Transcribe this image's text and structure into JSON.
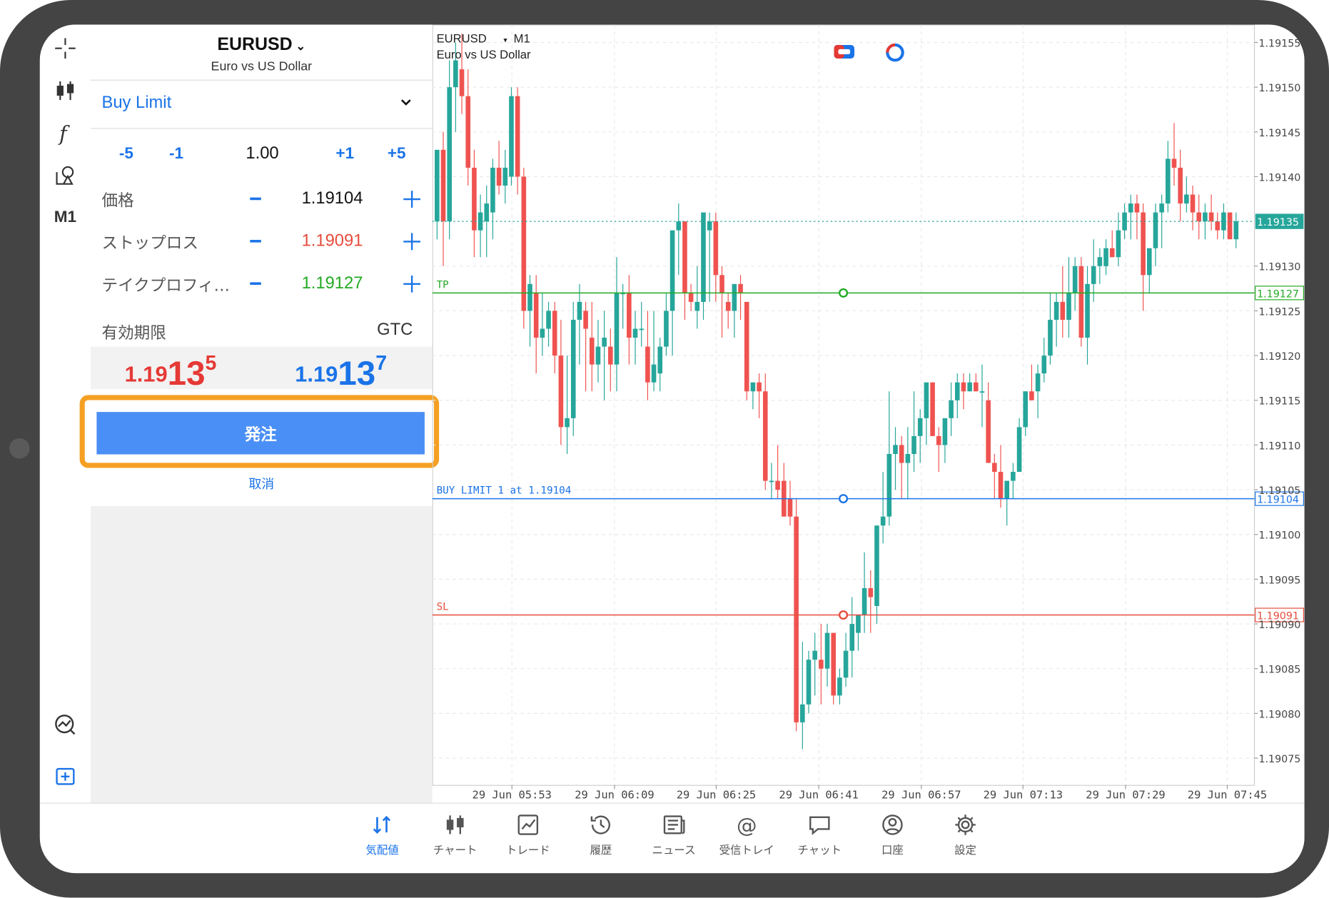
{
  "colors": {
    "bull": "#26a69a",
    "bear": "#ef5350",
    "accent": "#1a73e8",
    "tp": "#22aa22",
    "sl": "#e74c3c",
    "highlight": "#f5a023"
  },
  "toolbar": {
    "icons": [
      "crosshair-icon",
      "candles-icon",
      "function-icon",
      "objects-icon"
    ],
    "timeframe": "M1",
    "bottom_icons": [
      "analytics-icon",
      "new-order-icon"
    ]
  },
  "order": {
    "symbol": "EURUSD",
    "symbol_desc": "Euro vs US Dollar",
    "type": "Buy Limit",
    "volume_steps": [
      "-5",
      "-1",
      "+1",
      "+5"
    ],
    "volume": "1.00",
    "rows": [
      {
        "label": "価格",
        "value": "1.19104",
        "color": "#111111"
      },
      {
        "label": "ストップロス",
        "value": "1.19091",
        "color": "#e74c3c"
      },
      {
        "label": "テイクプロフィ…",
        "value": "1.19127",
        "color": "#22aa22"
      }
    ],
    "expiry_label": "有効期限",
    "expiry_value": "GTC",
    "bid": {
      "small": "1.19",
      "big": "13",
      "sup": "5"
    },
    "ask": {
      "small": "1.19",
      "big": "13",
      "sup": "7"
    },
    "place_button": "発注",
    "cancel_link": "取消"
  },
  "chart_data": {
    "type": "candlestick",
    "symbol": "EURUSD",
    "timeframe": "M1",
    "title": "EURUSD",
    "subtitle": "Euro vs US Dollar",
    "ylim": [
      1.19072,
      1.19157
    ],
    "y_ticks": [
      "1.19155",
      "1.19150",
      "1.19145",
      "1.19140",
      "1.19130",
      "1.19125",
      "1.19120",
      "1.19115",
      "1.19110",
      "1.19105",
      "1.19100",
      "1.19095",
      "1.19090",
      "1.19085",
      "1.19080",
      "1.19075"
    ],
    "x_ticks": [
      "29 Jun 05:53",
      "29 Jun 06:09",
      "29 Jun 06:25",
      "29 Jun 06:41",
      "29 Jun 06:57",
      "29 Jun 07:13",
      "29 Jun 07:29",
      "29 Jun 07:45"
    ],
    "current_price": "1.19135",
    "lines": [
      {
        "name": "TP",
        "label": "TP",
        "price": "1.19127",
        "color": "#22aa22",
        "style": "solid"
      },
      {
        "name": "BUY LIMIT",
        "label": "BUY LIMIT 1 at 1.19104",
        "price": "1.19104",
        "color": "#1a73e8",
        "style": "solid"
      },
      {
        "name": "SL",
        "label": "SL",
        "price": "1.19091",
        "color": "#e74c3c",
        "style": "solid"
      },
      {
        "name": "Bid",
        "label": "",
        "price": "1.19135",
        "color": "#26a69a",
        "style": "dotted"
      }
    ],
    "candles": [
      {
        "o": 1.19135,
        "h": 1.1914,
        "l": 1.19133,
        "c": 1.19143
      },
      {
        "o": 1.19143,
        "h": 1.19145,
        "l": 1.1913,
        "c": 1.19135
      },
      {
        "o": 1.19135,
        "h": 1.19153,
        "l": 1.19133,
        "c": 1.1915
      },
      {
        "o": 1.1915,
        "h": 1.19155,
        "l": 1.19145,
        "c": 1.19153
      },
      {
        "o": 1.19152,
        "h": 1.19156,
        "l": 1.19147,
        "c": 1.19149
      },
      {
        "o": 1.19149,
        "h": 1.19152,
        "l": 1.19139,
        "c": 1.19141
      },
      {
        "o": 1.19141,
        "h": 1.19143,
        "l": 1.19131,
        "c": 1.19134
      },
      {
        "o": 1.19134,
        "h": 1.19138,
        "l": 1.19131,
        "c": 1.19136
      },
      {
        "o": 1.19135,
        "h": 1.19139,
        "l": 1.19131,
        "c": 1.19137
      },
      {
        "o": 1.19136,
        "h": 1.19142,
        "l": 1.19133,
        "c": 1.19141
      },
      {
        "o": 1.19141,
        "h": 1.19144,
        "l": 1.19138,
        "c": 1.19139
      },
      {
        "o": 1.19139,
        "h": 1.19143,
        "l": 1.19137,
        "c": 1.19141
      },
      {
        "o": 1.1914,
        "h": 1.1915,
        "l": 1.19139,
        "c": 1.19149
      },
      {
        "o": 1.19149,
        "h": 1.1915,
        "l": 1.19138,
        "c": 1.1914
      },
      {
        "o": 1.1914,
        "h": 1.19141,
        "l": 1.19123,
        "c": 1.19125
      },
      {
        "o": 1.19125,
        "h": 1.19129,
        "l": 1.19121,
        "c": 1.19128
      },
      {
        "o": 1.19127,
        "h": 1.19129,
        "l": 1.19118,
        "c": 1.19122
      },
      {
        "o": 1.19122,
        "h": 1.19127,
        "l": 1.1912,
        "c": 1.19123
      },
      {
        "o": 1.19123,
        "h": 1.19126,
        "l": 1.19121,
        "c": 1.19125
      },
      {
        "o": 1.19125,
        "h": 1.19126,
        "l": 1.19118,
        "c": 1.1912
      },
      {
        "o": 1.1912,
        "h": 1.19124,
        "l": 1.1911,
        "c": 1.19112
      },
      {
        "o": 1.19112,
        "h": 1.1912,
        "l": 1.19109,
        "c": 1.19113
      },
      {
        "o": 1.19113,
        "h": 1.19126,
        "l": 1.19111,
        "c": 1.19124
      },
      {
        "o": 1.19124,
        "h": 1.19128,
        "l": 1.19119,
        "c": 1.19126
      },
      {
        "o": 1.19125,
        "h": 1.19126,
        "l": 1.19116,
        "c": 1.19123
      },
      {
        "o": 1.19122,
        "h": 1.19126,
        "l": 1.19116,
        "c": 1.19119
      },
      {
        "o": 1.19119,
        "h": 1.19124,
        "l": 1.19117,
        "c": 1.19121
      },
      {
        "o": 1.19121,
        "h": 1.19125,
        "l": 1.19115,
        "c": 1.19122
      },
      {
        "o": 1.19121,
        "h": 1.19123,
        "l": 1.19116,
        "c": 1.19119
      },
      {
        "o": 1.19119,
        "h": 1.19131,
        "l": 1.19116,
        "c": 1.19127
      },
      {
        "o": 1.19127,
        "h": 1.19128,
        "l": 1.19123,
        "c": 1.19127
      },
      {
        "o": 1.19127,
        "h": 1.19129,
        "l": 1.19119,
        "c": 1.19122
      },
      {
        "o": 1.19122,
        "h": 1.19125,
        "l": 1.19119,
        "c": 1.19123
      },
      {
        "o": 1.19123,
        "h": 1.19126,
        "l": 1.19121,
        "c": 1.19123
      },
      {
        "o": 1.19121,
        "h": 1.19125,
        "l": 1.19115,
        "c": 1.19117
      },
      {
        "o": 1.19117,
        "h": 1.19125,
        "l": 1.19116,
        "c": 1.19119
      },
      {
        "o": 1.19118,
        "h": 1.19122,
        "l": 1.19116,
        "c": 1.19121
      },
      {
        "o": 1.19121,
        "h": 1.19127,
        "l": 1.1912,
        "c": 1.19125
      },
      {
        "o": 1.19125,
        "h": 1.19132,
        "l": 1.1912,
        "c": 1.19134
      },
      {
        "o": 1.19134,
        "h": 1.19137,
        "l": 1.19129,
        "c": 1.19135
      },
      {
        "o": 1.19135,
        "h": 1.19135,
        "l": 1.19124,
        "c": 1.19127
      },
      {
        "o": 1.19127,
        "h": 1.19128,
        "l": 1.19125,
        "c": 1.19126
      },
      {
        "o": 1.19125,
        "h": 1.1913,
        "l": 1.19123,
        "c": 1.19126
      },
      {
        "o": 1.19126,
        "h": 1.19136,
        "l": 1.19124,
        "c": 1.19136
      },
      {
        "o": 1.19134,
        "h": 1.19136,
        "l": 1.19126,
        "c": 1.19135
      },
      {
        "o": 1.19135,
        "h": 1.19136,
        "l": 1.19126,
        "c": 1.19129
      },
      {
        "o": 1.19129,
        "h": 1.1913,
        "l": 1.19122,
        "c": 1.19127
      },
      {
        "o": 1.19126,
        "h": 1.19127,
        "l": 1.19123,
        "c": 1.19125
      },
      {
        "o": 1.19125,
        "h": 1.19128,
        "l": 1.19122,
        "c": 1.19128
      },
      {
        "o": 1.19128,
        "h": 1.19129,
        "l": 1.19124,
        "c": 1.19127
      },
      {
        "o": 1.19126,
        "h": 1.19126,
        "l": 1.19115,
        "c": 1.19116
      },
      {
        "o": 1.19116,
        "h": 1.19117,
        "l": 1.19114,
        "c": 1.19117
      },
      {
        "o": 1.19117,
        "h": 1.19118,
        "l": 1.19113,
        "c": 1.19116
      },
      {
        "o": 1.19116,
        "h": 1.19118,
        "l": 1.19105,
        "c": 1.19106
      },
      {
        "o": 1.19106,
        "h": 1.19108,
        "l": 1.19104,
        "c": 1.19106
      },
      {
        "o": 1.19106,
        "h": 1.1911,
        "l": 1.19104,
        "c": 1.19105
      },
      {
        "o": 1.19106,
        "h": 1.19108,
        "l": 1.19102,
        "c": 1.19102
      },
      {
        "o": 1.19104,
        "h": 1.19106,
        "l": 1.19101,
        "c": 1.19102
      },
      {
        "o": 1.19102,
        "h": 1.19104,
        "l": 1.19078,
        "c": 1.19079
      },
      {
        "o": 1.19079,
        "h": 1.19088,
        "l": 1.19076,
        "c": 1.19081
      },
      {
        "o": 1.19081,
        "h": 1.19087,
        "l": 1.1908,
        "c": 1.19086
      },
      {
        "o": 1.19086,
        "h": 1.19089,
        "l": 1.19082,
        "c": 1.19087
      },
      {
        "o": 1.19086,
        "h": 1.1909,
        "l": 1.19081,
        "c": 1.19085
      },
      {
        "o": 1.19085,
        "h": 1.1909,
        "l": 1.19083,
        "c": 1.19089
      },
      {
        "o": 1.19089,
        "h": 1.19089,
        "l": 1.19081,
        "c": 1.19082
      },
      {
        "o": 1.19082,
        "h": 1.19085,
        "l": 1.19081,
        "c": 1.19084
      },
      {
        "o": 1.19084,
        "h": 1.19089,
        "l": 1.19083,
        "c": 1.19087
      },
      {
        "o": 1.19087,
        "h": 1.19093,
        "l": 1.19084,
        "c": 1.1909
      },
      {
        "o": 1.19089,
        "h": 1.19091,
        "l": 1.19087,
        "c": 1.19091
      },
      {
        "o": 1.19091,
        "h": 1.19098,
        "l": 1.19089,
        "c": 1.19094
      },
      {
        "o": 1.19094,
        "h": 1.19096,
        "l": 1.19089,
        "c": 1.19093
      },
      {
        "o": 1.19092,
        "h": 1.19101,
        "l": 1.1909,
        "c": 1.19101
      },
      {
        "o": 1.19101,
        "h": 1.19107,
        "l": 1.19099,
        "c": 1.19102
      },
      {
        "o": 1.19102,
        "h": 1.19116,
        "l": 1.19101,
        "c": 1.19109
      },
      {
        "o": 1.19109,
        "h": 1.19112,
        "l": 1.19105,
        "c": 1.1911
      },
      {
        "o": 1.1911,
        "h": 1.19111,
        "l": 1.19104,
        "c": 1.19108
      },
      {
        "o": 1.19108,
        "h": 1.19112,
        "l": 1.19104,
        "c": 1.19109
      },
      {
        "o": 1.19109,
        "h": 1.19116,
        "l": 1.19107,
        "c": 1.19111
      },
      {
        "o": 1.19111,
        "h": 1.19114,
        "l": 1.19108,
        "c": 1.19113
      },
      {
        "o": 1.19113,
        "h": 1.19117,
        "l": 1.1911,
        "c": 1.19117
      },
      {
        "o": 1.19117,
        "h": 1.19117,
        "l": 1.19111,
        "c": 1.19111
      },
      {
        "o": 1.19111,
        "h": 1.19112,
        "l": 1.19107,
        "c": 1.1911
      },
      {
        "o": 1.1911,
        "h": 1.19112,
        "l": 1.19108,
        "c": 1.19113
      },
      {
        "o": 1.19113,
        "h": 1.19117,
        "l": 1.19111,
        "c": 1.19115
      },
      {
        "o": 1.19115,
        "h": 1.19118,
        "l": 1.19113,
        "c": 1.19117
      },
      {
        "o": 1.19117,
        "h": 1.19118,
        "l": 1.19114,
        "c": 1.19116
      },
      {
        "o": 1.19116,
        "h": 1.19118,
        "l": 1.19116,
        "c": 1.19117
      },
      {
        "o": 1.19117,
        "h": 1.19118,
        "l": 1.19116,
        "c": 1.19116
      },
      {
        "o": 1.19116,
        "h": 1.19119,
        "l": 1.19112,
        "c": 1.19116
      },
      {
        "o": 1.19115,
        "h": 1.19117,
        "l": 1.19109,
        "c": 1.19108
      },
      {
        "o": 1.19108,
        "h": 1.19109,
        "l": 1.19104,
        "c": 1.19107
      },
      {
        "o": 1.19107,
        "h": 1.1911,
        "l": 1.19103,
        "c": 1.19104
      },
      {
        "o": 1.19104,
        "h": 1.19105,
        "l": 1.19101,
        "c": 1.19106
      },
      {
        "o": 1.19106,
        "h": 1.19108,
        "l": 1.19104,
        "c": 1.19107
      },
      {
        "o": 1.19107,
        "h": 1.19113,
        "l": 1.19107,
        "c": 1.19112
      },
      {
        "o": 1.19112,
        "h": 1.19116,
        "l": 1.19111,
        "c": 1.19116
      },
      {
        "o": 1.19116,
        "h": 1.19119,
        "l": 1.19115,
        "c": 1.19115
      },
      {
        "o": 1.19116,
        "h": 1.19119,
        "l": 1.19113,
        "c": 1.19118
      },
      {
        "o": 1.19118,
        "h": 1.19122,
        "l": 1.19117,
        "c": 1.1912
      },
      {
        "o": 1.1912,
        "h": 1.19127,
        "l": 1.19119,
        "c": 1.19124
      },
      {
        "o": 1.19124,
        "h": 1.19127,
        "l": 1.19121,
        "c": 1.19126
      },
      {
        "o": 1.19126,
        "h": 1.1913,
        "l": 1.19122,
        "c": 1.19124
      },
      {
        "o": 1.19124,
        "h": 1.19131,
        "l": 1.19122,
        "c": 1.19127
      },
      {
        "o": 1.19127,
        "h": 1.19131,
        "l": 1.19125,
        "c": 1.1913
      },
      {
        "o": 1.1913,
        "h": 1.19131,
        "l": 1.19121,
        "c": 1.19122
      },
      {
        "o": 1.19122,
        "h": 1.1913,
        "l": 1.19119,
        "c": 1.19128
      },
      {
        "o": 1.19128,
        "h": 1.19133,
        "l": 1.19126,
        "c": 1.1913
      },
      {
        "o": 1.1913,
        "h": 1.19132,
        "l": 1.19128,
        "c": 1.19131
      },
      {
        "o": 1.1913,
        "h": 1.19133,
        "l": 1.19129,
        "c": 1.19132
      },
      {
        "o": 1.19132,
        "h": 1.19134,
        "l": 1.19131,
        "c": 1.19131
      },
      {
        "o": 1.19131,
        "h": 1.19136,
        "l": 1.1913,
        "c": 1.19134
      },
      {
        "o": 1.19134,
        "h": 1.19137,
        "l": 1.19133,
        "c": 1.19136
      },
      {
        "o": 1.19136,
        "h": 1.19138,
        "l": 1.19133,
        "c": 1.19137
      },
      {
        "o": 1.19137,
        "h": 1.19138,
        "l": 1.19133,
        "c": 1.19136
      },
      {
        "o": 1.19136,
        "h": 1.19137,
        "l": 1.19125,
        "c": 1.19129
      },
      {
        "o": 1.19129,
        "h": 1.19132,
        "l": 1.19127,
        "c": 1.19132
      },
      {
        "o": 1.19132,
        "h": 1.19137,
        "l": 1.1913,
        "c": 1.19136
      },
      {
        "o": 1.19136,
        "h": 1.19138,
        "l": 1.19132,
        "c": 1.19137
      },
      {
        "o": 1.19137,
        "h": 1.19144,
        "l": 1.19136,
        "c": 1.19142
      },
      {
        "o": 1.19142,
        "h": 1.19146,
        "l": 1.19139,
        "c": 1.19141
      },
      {
        "o": 1.19141,
        "h": 1.19143,
        "l": 1.19135,
        "c": 1.19137
      },
      {
        "o": 1.19137,
        "h": 1.1914,
        "l": 1.19136,
        "c": 1.19138
      },
      {
        "o": 1.19138,
        "h": 1.19139,
        "l": 1.19134,
        "c": 1.19136
      },
      {
        "o": 1.19136,
        "h": 1.19138,
        "l": 1.19133,
        "c": 1.19135
      },
      {
        "o": 1.19135,
        "h": 1.19137,
        "l": 1.19133,
        "c": 1.19136
      },
      {
        "o": 1.19136,
        "h": 1.19138,
        "l": 1.19134,
        "c": 1.19135
      },
      {
        "o": 1.19135,
        "h": 1.19136,
        "l": 1.19133,
        "c": 1.19134
      },
      {
        "o": 1.19134,
        "h": 1.19137,
        "l": 1.19133,
        "c": 1.19136
      },
      {
        "o": 1.19136,
        "h": 1.19136,
        "l": 1.19133,
        "c": 1.19133
      },
      {
        "o": 1.19133,
        "h": 1.19136,
        "l": 1.19132,
        "c": 1.19135
      }
    ]
  },
  "bottom_nav": [
    {
      "icon": "quotes-icon",
      "label": "気配値",
      "active": true
    },
    {
      "icon": "chart-icon",
      "label": "チャート",
      "active": false
    },
    {
      "icon": "trade-icon",
      "label": "トレード",
      "active": false
    },
    {
      "icon": "history-icon",
      "label": "履歴",
      "active": false
    },
    {
      "icon": "news-icon",
      "label": "ニュース",
      "active": false
    },
    {
      "icon": "mailbox-icon",
      "label": "受信トレイ",
      "active": false
    },
    {
      "icon": "chat-icon",
      "label": "チャット",
      "active": false
    },
    {
      "icon": "account-icon",
      "label": "口座",
      "active": false
    },
    {
      "icon": "settings-icon",
      "label": "設定",
      "active": false
    }
  ]
}
